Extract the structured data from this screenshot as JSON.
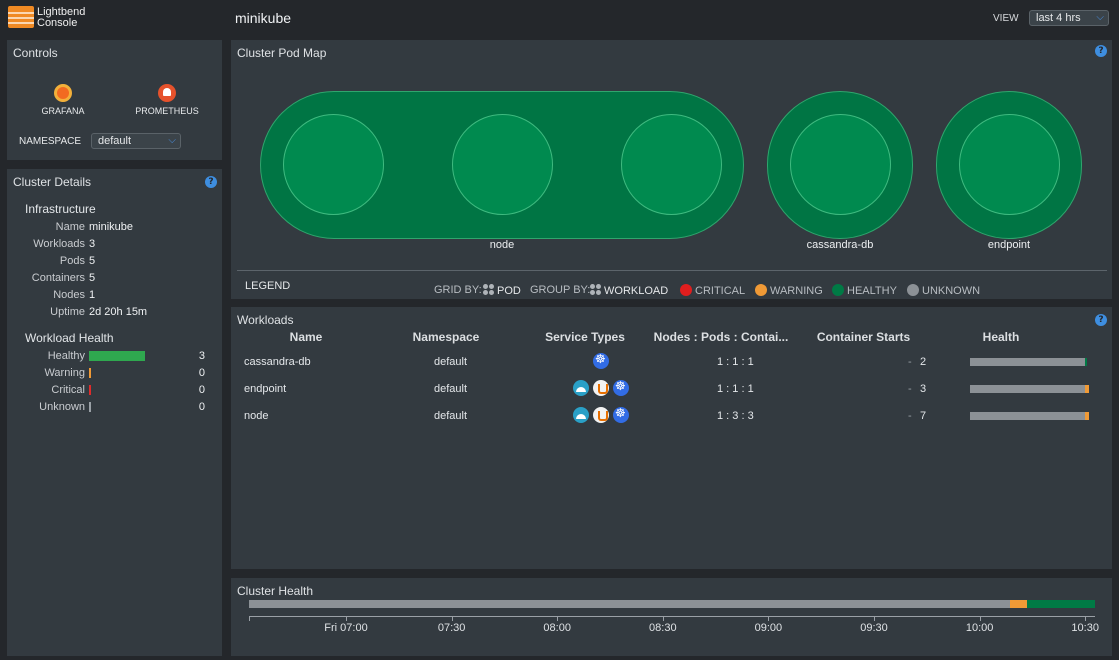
{
  "header": {
    "logo_line1": "Lightbend",
    "logo_line2": "Console",
    "cluster_name": "minikube",
    "view_label": "VIEW",
    "view_value": "last 4 hrs"
  },
  "controls": {
    "title": "Controls",
    "grafana_label": "GRAFANA",
    "prometheus_label": "PROMETHEUS",
    "namespace_label": "NAMESPACE",
    "namespace_value": "default"
  },
  "details": {
    "title": "Cluster Details",
    "help": "?",
    "infra_title": "Infrastructure",
    "infra": [
      {
        "k": "Name",
        "v": "minikube"
      },
      {
        "k": "Workloads",
        "v": "3"
      },
      {
        "k": "Pods",
        "v": "5"
      },
      {
        "k": "Containers",
        "v": "5"
      },
      {
        "k": "Nodes",
        "v": "1"
      },
      {
        "k": "Uptime",
        "v": "2d 20h 15m"
      }
    ],
    "health_title": "Workload Health",
    "health": [
      {
        "k": "Healthy",
        "v": "3",
        "color": "#2fa84f"
      },
      {
        "k": "Warning",
        "v": "0",
        "color": "#f09a36"
      },
      {
        "k": "Critical",
        "v": "0",
        "color": "#e02b2b"
      },
      {
        "k": "Unknown",
        "v": "0",
        "color": "#9aa0a6"
      }
    ]
  },
  "podmap": {
    "title": "Cluster Pod Map",
    "help": "?",
    "groups": [
      {
        "label": "node",
        "pods": 3
      },
      {
        "label": "cassandra-db",
        "pods": 1
      },
      {
        "label": "endpoint",
        "pods": 1
      }
    ],
    "legend": {
      "title": "LEGEND",
      "grid_by_label": "GRID BY:",
      "grid_by_value": "POD",
      "group_by_label": "GROUP BY:",
      "group_by_value": "WORKLOAD",
      "critical": "CRITICAL",
      "warning": "WARNING",
      "healthy": "HEALTHY",
      "unknown": "UNKNOWN"
    }
  },
  "workloads": {
    "title": "Workloads",
    "help": "?",
    "columns": [
      "Name",
      "Namespace",
      "Service Types",
      "Nodes : Pods : Contai...",
      "Container Starts",
      "Health"
    ],
    "rows": [
      {
        "name": "cassandra-db",
        "namespace": "default",
        "services": [
          "kubernetes-icon"
        ],
        "npc": "1 : 1 : 1",
        "starts_dash": "-",
        "starts": "2",
        "health": {
          "unknown": 0.96,
          "warning": 0.0,
          "healthy": 0.02
        }
      },
      {
        "name": "endpoint",
        "namespace": "default",
        "services": [
          "lightbend-icon",
          "java-icon",
          "kubernetes-icon"
        ],
        "npc": "1 : 1 : 1",
        "starts_dash": "-",
        "starts": "3",
        "health": {
          "unknown": 0.96,
          "warning": 0.03,
          "healthy": 0.0
        }
      },
      {
        "name": "node",
        "namespace": "default",
        "services": [
          "lightbend-icon",
          "java-icon",
          "kubernetes-icon"
        ],
        "npc": "1 : 3 : 3",
        "starts_dash": "-",
        "starts": "7",
        "health": {
          "unknown": 0.96,
          "warning": 0.03,
          "healthy": 0.0
        }
      }
    ]
  },
  "cluster_health": {
    "title": "Cluster Health",
    "segments": {
      "unknown": 0.9,
      "warning": 0.02,
      "healthy": 0.08
    },
    "ticks": [
      "Fri 07:00",
      "07:30",
      "08:00",
      "08:30",
      "09:00",
      "09:30",
      "10:00",
      "10:30"
    ]
  },
  "colors": {
    "healthy": "#007a45",
    "warning": "#f09a36",
    "critical": "#e01e1e",
    "unknown": "#8c9196",
    "accent": "#4a90e2"
  }
}
